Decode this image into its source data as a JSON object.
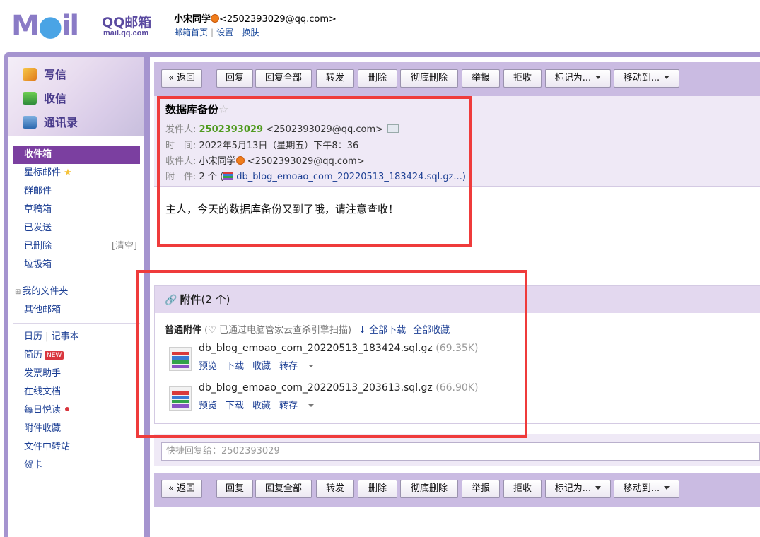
{
  "header": {
    "logo_text": "Mail",
    "logo_cn": "QQ邮箱",
    "logo_url": "mail.qq.com",
    "user_name": "小宋同学",
    "user_email": "<2502393029@qq.com>",
    "link_home": "邮箱首页",
    "link_settings": "设置",
    "link_skin": "换肤"
  },
  "quick": {
    "write": "写信",
    "receive": "收信",
    "contacts": "通讯录"
  },
  "folders": {
    "inbox": "收件箱",
    "starred": "星标邮件",
    "group": "群邮件",
    "drafts": "草稿箱",
    "sent": "已发送",
    "deleted": "已删除",
    "clear": "[清空]",
    "spam": "垃圾箱",
    "my_folders": "我的文件夹",
    "other": "其他邮箱",
    "calendar": "日历",
    "notes": "记事本",
    "resume": "简历",
    "new_badge": "NEW",
    "invoice": "发票助手",
    "docs": "在线文档",
    "daily": "每日悦读",
    "att_fav": "附件收藏",
    "transfer": "文件中转站",
    "card": "贺卡"
  },
  "toolbar": {
    "back": "« 返回",
    "reply": "回复",
    "reply_all": "回复全部",
    "forward": "转发",
    "delete": "删除",
    "delete_forever": "彻底删除",
    "report": "举报",
    "reject": "拒收",
    "mark_as": "标记为...",
    "move_to": "移动到..."
  },
  "mail": {
    "subject": "数据库备份",
    "from_label": "发件人:",
    "from_name": "2502393029",
    "from_email": "<2502393029@qq.com>",
    "time_label": "时　间:",
    "time": "2022年5月13日（星期五）下午8：36",
    "to_label": "收件人:",
    "to_name": "小宋同学",
    "to_email": "<2502393029@qq.com>",
    "att_label": "附　件:",
    "att_count": "2 个 (",
    "att_first": "db_blog_emoao_com_20220513_183424.sql.gz...)",
    "body": "主人，今天的数据库备份又到了哦，请注意查收！"
  },
  "attachments": {
    "title": "附件",
    "count": "(2 个)",
    "normal": "普通附件",
    "scanned": "(♡ 已通过电脑管家云查杀引擎扫描)",
    "download_all": "全部下载",
    "save_all": "全部收藏",
    "files": [
      {
        "name": "db_blog_emoao_com_20220513_183424.sql.gz",
        "size": "(69.35K)"
      },
      {
        "name": "db_blog_emoao_com_20220513_203613.sql.gz",
        "size": "(66.90K)"
      }
    ],
    "preview": "预览",
    "download": "下载",
    "save": "收藏",
    "transfer": "转存"
  },
  "reply": {
    "placeholder": "快捷回复给：2502393029"
  },
  "colors": {
    "frame": "#a594cf",
    "active_folder": "#7b3fa0",
    "toolbar": "#cabbe2",
    "highlight_box": "#ef3b3b",
    "sender": "#4f9a1e"
  }
}
